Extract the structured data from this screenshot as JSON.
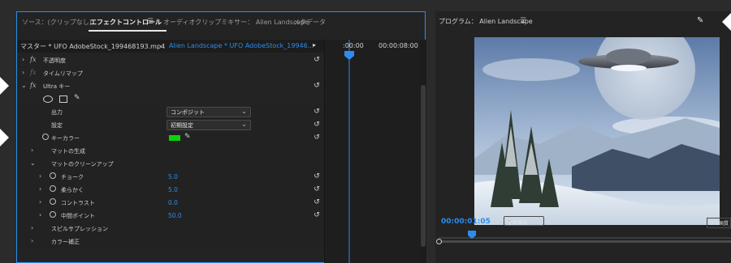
{
  "effect_controls": {
    "tabs": [
      {
        "label": "ソース：(クリップなし)"
      },
      {
        "label": "エフェクトコントロール"
      },
      {
        "label": "オーディオクリップミキサー： Alien Landscape"
      },
      {
        "label": "メタデータ"
      }
    ],
    "source_label": "マスター * UFO AdobeStock_199468193.mp4",
    "sequence_label": "Alien Landscape * UFO AdobeStock_19946...",
    "timecode_start": ":00:00",
    "timecode_end": "00:00:08:00",
    "properties": {
      "opacity": "不透明度",
      "time_remap": "タイムリマップ",
      "ultra_key": "Ultra キー",
      "output_label": "出力",
      "output_value": "コンポジット",
      "setting_label": "設定",
      "setting_value": "初期設定",
      "key_color_label": "キーカラー",
      "matte_generation": "マットの生成",
      "matte_cleanup": "マットのクリーンアップ",
      "choke_label": "チョーク",
      "choke_value": "5.0",
      "soften_label": "柔らかく",
      "soften_value": "5.0",
      "contrast_label": "コントラスト",
      "contrast_value": "0.0",
      "midpoint_label": "中間ポイント",
      "midpoint_value": "50.0",
      "spill_suppression": "スピルサプレッション",
      "color_correction": "カラー補正"
    }
  },
  "program_monitor": {
    "title": "プログラム： Alien Landscape",
    "timecode": "00:00:01:05",
    "fit_label": "全体表示",
    "quality_label": "フル画質"
  },
  "colors": {
    "accent": "#2d8ceb",
    "key_color": "#0bd20b"
  }
}
